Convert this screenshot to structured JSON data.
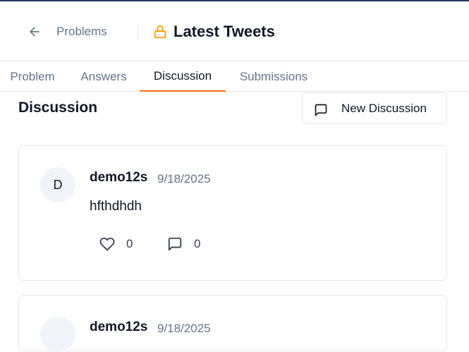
{
  "header": {
    "back_label": "Problems",
    "title": "Latest Tweets",
    "lock_color": "#f59e0b"
  },
  "tabs": [
    {
      "label": "Problem",
      "active": false
    },
    {
      "label": "Answers",
      "active": false
    },
    {
      "label": "Discussion",
      "active": true
    },
    {
      "label": "Submissions",
      "active": false
    }
  ],
  "discussion": {
    "title": "Discussion",
    "new_button_label": "New Discussion",
    "posts": [
      {
        "avatar_initial": "D",
        "author": "demo12s",
        "date": "9/18/2025",
        "body": "hfthdhdh",
        "likes": "0",
        "replies": "0"
      },
      {
        "avatar_initial": "",
        "author": "demo12s",
        "date": "9/18/2025",
        "body": "",
        "likes": "",
        "replies": ""
      }
    ]
  },
  "colors": {
    "accent": "#f97316",
    "muted_text": "#64748b",
    "border": "#e5e7eb"
  }
}
